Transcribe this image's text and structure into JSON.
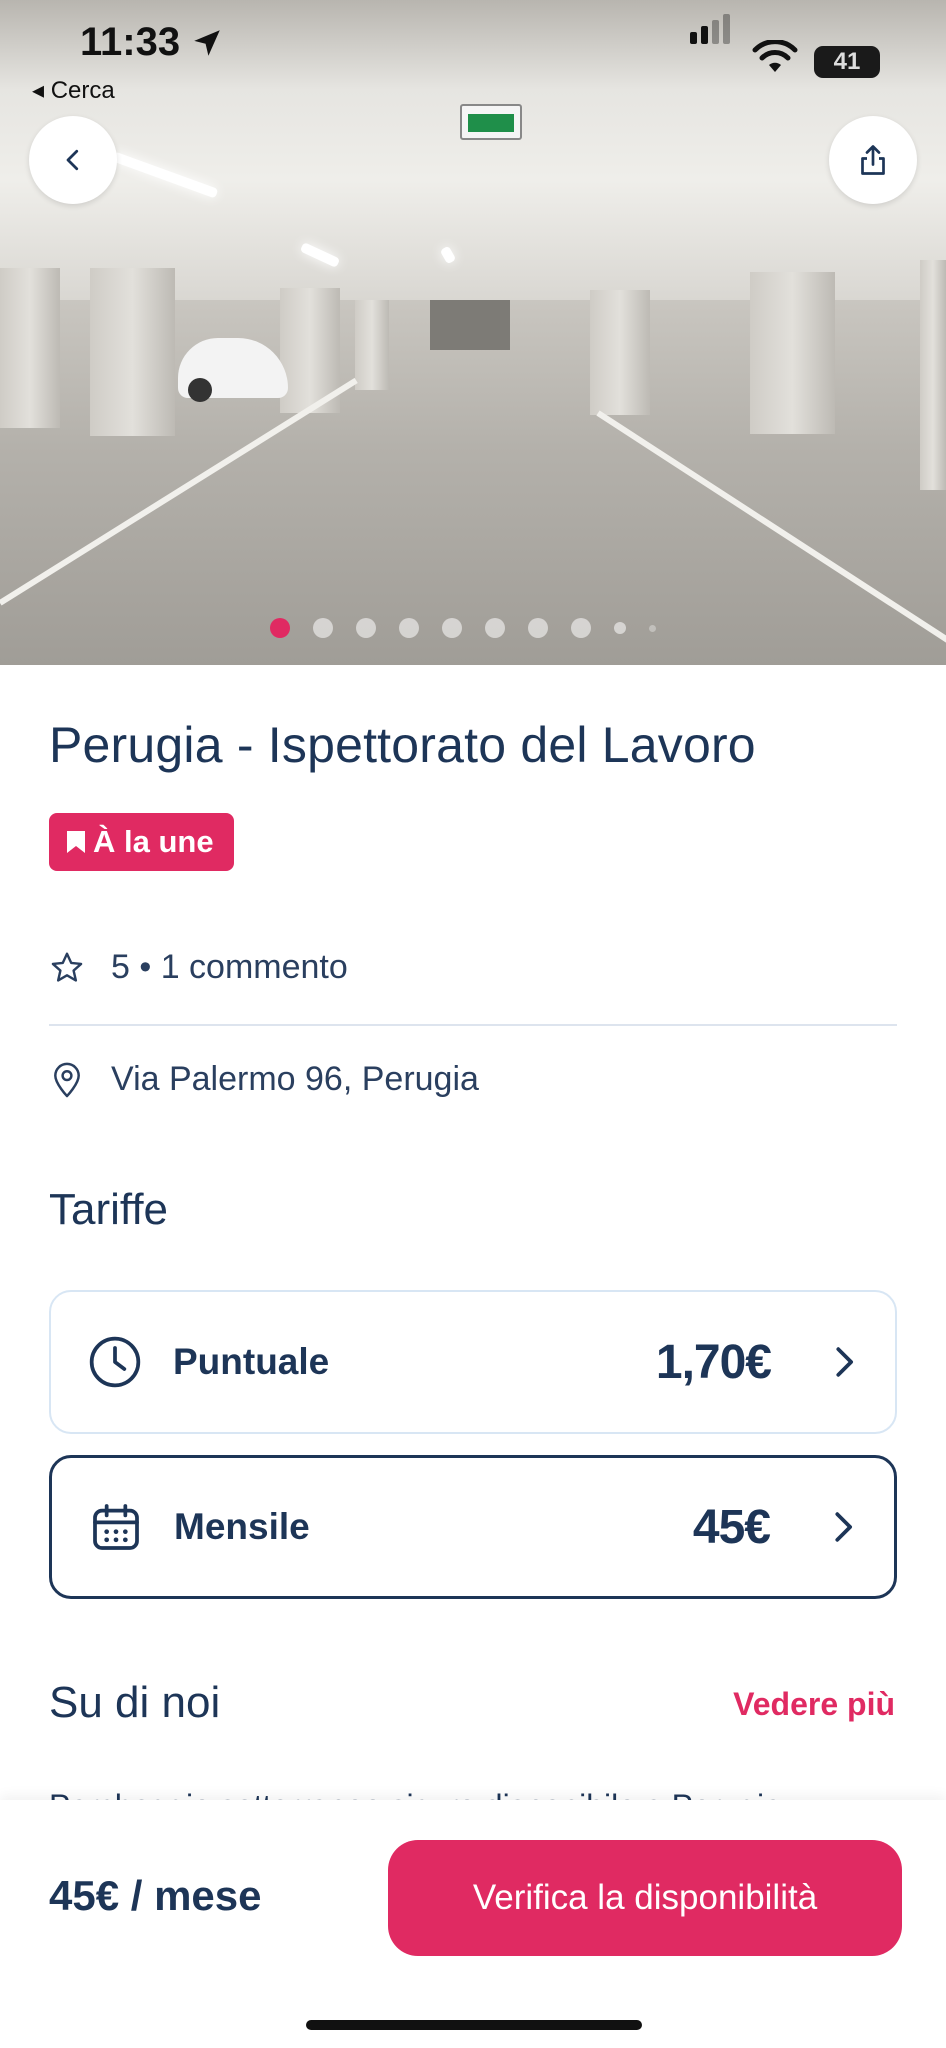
{
  "status_bar": {
    "time": "11:33",
    "back_app_label": "◂ Cerca",
    "battery": "41"
  },
  "hero": {
    "image_description": "Underground parking garage",
    "image_count": 10,
    "active_index": 0
  },
  "listing": {
    "title": "Perugia - Ispettorato del Lavoro",
    "badge_label": "À la une",
    "rating": "5 • 1 commento",
    "address": "Via Palermo 96, Perugia"
  },
  "rates": {
    "section_title": "Tariffe",
    "items": [
      {
        "label": "Puntuale",
        "price": "1,70€",
        "icon": "clock-icon"
      },
      {
        "label": "Mensile",
        "price": "45€",
        "icon": "calendar-icon"
      }
    ]
  },
  "about": {
    "section_title": "Su di noi",
    "see_more_label": "Vedere più",
    "preview_text": "Parcheggio sotterraneo sicuro disponibile a Perugia"
  },
  "footer": {
    "price_summary": "45€ / mese",
    "cta_label": "Verifica la disponibilità"
  },
  "colors": {
    "accent": "#e02a62",
    "navy": "#1d3557",
    "divider": "#dde4ee"
  }
}
